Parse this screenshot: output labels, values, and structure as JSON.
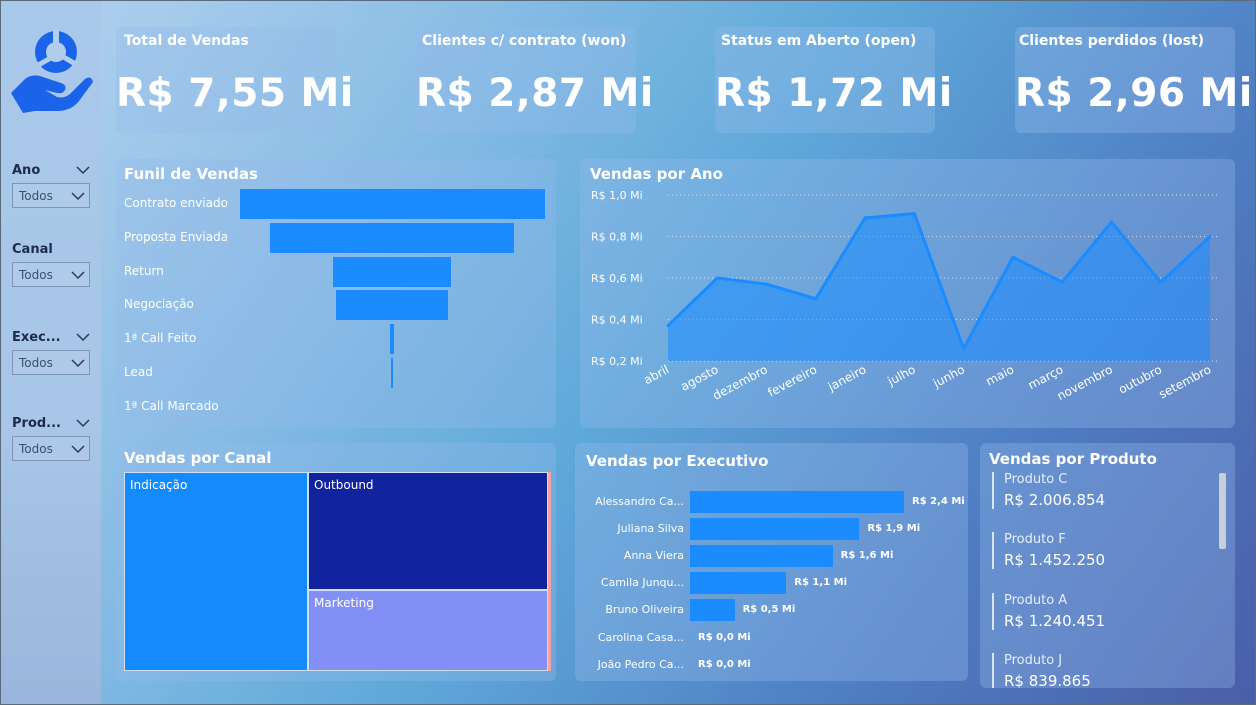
{
  "filters": [
    {
      "label": "Ano",
      "value": "Todos"
    },
    {
      "label": "Canal",
      "value": "Todos"
    },
    {
      "label": "Exec...",
      "value": "Todos"
    },
    {
      "label": "Prod...",
      "value": "Todos"
    }
  ],
  "kpis": [
    {
      "title": "Total de Vendas",
      "value": "R$ 7,55 Mi"
    },
    {
      "title": "Clientes c/ contrato (won)",
      "value": "R$ 2,87 Mi"
    },
    {
      "title": "Status em Aberto (open)",
      "value": "R$ 1,72 Mi"
    },
    {
      "title": "Clientes perdidos (lost)",
      "value": "R$ 2,96 Mi"
    }
  ],
  "funnel": {
    "title": "Funil de Vendas",
    "stages": [
      {
        "label": "Contrato enviado",
        "share": 1.0
      },
      {
        "label": "Proposta Enviada",
        "share": 0.8
      },
      {
        "label": "Return",
        "share": 0.39
      },
      {
        "label": "Negociação",
        "share": 0.37
      },
      {
        "label": "1ª Call Feito",
        "share": 0.013
      },
      {
        "label": "Lead",
        "share": 0.005
      },
      {
        "label": "1ª Call Marcado",
        "share": 0.0
      }
    ]
  },
  "chart_data": {
    "type": "area",
    "title": "Vendas por Ano",
    "categories": [
      "abril",
      "agosto",
      "dezembro",
      "fevereiro",
      "janeiro",
      "julho",
      "junho",
      "maio",
      "março",
      "novembro",
      "outubro",
      "setembro"
    ],
    "values": [
      0.37,
      0.6,
      0.57,
      0.5,
      0.89,
      0.91,
      0.26,
      0.7,
      0.58,
      0.87,
      0.58,
      0.8
    ],
    "yticks": [
      "R$ 0,2 Mi",
      "R$ 0,4 Mi",
      "R$ 0,6 Mi",
      "R$ 0,8 Mi",
      "R$ 1,0 Mi"
    ],
    "ylim": [
      0.2,
      1.0
    ],
    "grid": true,
    "color": "#1a8cff"
  },
  "canal": {
    "title": "Vendas por Canal",
    "items": [
      {
        "label": "Indicação",
        "color": "#138bfd"
      },
      {
        "label": "Outbound",
        "color": "#12239e"
      },
      {
        "label": "Marketing",
        "color": "#828ff4"
      }
    ]
  },
  "executivos": {
    "title": "Vendas por Executivo",
    "max": 2.4,
    "items": [
      {
        "name": "Alessandro Ca...",
        "value": 2.4,
        "label": "R$ 2,4 Mi"
      },
      {
        "name": "Juliana Silva",
        "value": 1.9,
        "label": "R$ 1,9 Mi"
      },
      {
        "name": "Anna Viera",
        "value": 1.6,
        "label": "R$ 1,6 Mi"
      },
      {
        "name": "Camila Junqu...",
        "value": 1.08,
        "label": "R$ 1,1 Mi"
      },
      {
        "name": "Bruno Oliveira",
        "value": 0.5,
        "label": "R$ 0,5 Mi"
      },
      {
        "name": "Carolina Casa...",
        "value": 0.0,
        "label": "R$ 0,0 Mi"
      },
      {
        "name": "João Pedro Ca...",
        "value": 0.0,
        "label": "R$ 0,0 Mi"
      }
    ]
  },
  "produtos": {
    "title": "Vendas por Produto",
    "items": [
      {
        "name": "Produto C",
        "value": "R$ 2.006.854"
      },
      {
        "name": "Produto F",
        "value": "R$ 1.452.250"
      },
      {
        "name": "Produto A",
        "value": "R$ 1.240.451"
      },
      {
        "name": "Produto J",
        "value": "R$ 839.865"
      }
    ]
  }
}
